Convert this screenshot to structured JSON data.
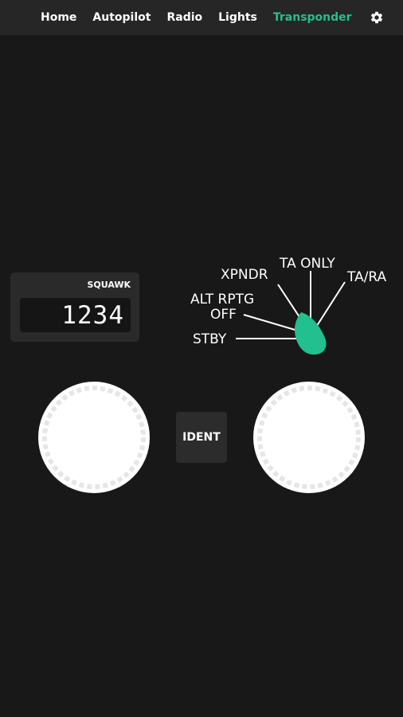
{
  "nav": {
    "items": [
      {
        "label": "Home",
        "active": false
      },
      {
        "label": "Autopilot",
        "active": false
      },
      {
        "label": "Radio",
        "active": false
      },
      {
        "label": "Lights",
        "active": false
      },
      {
        "label": "Transponder",
        "active": true
      }
    ],
    "settings_icon": "gear-icon",
    "active_color": "#22c08f"
  },
  "squawk": {
    "label": "SQUAWK",
    "code": "1234"
  },
  "mode_selector": {
    "modes": [
      "STBY",
      "ALT RPTG OFF",
      "XPNDR",
      "TA ONLY",
      "TA/RA"
    ],
    "labels": {
      "stby": "STBY",
      "alt_rptg": "ALT RPTG",
      "off": "OFF",
      "xpndr": "XPNDR",
      "ta_only": "TA ONLY",
      "ta_ra": "TA/RA"
    },
    "selected": "TA/RA",
    "knob_color": "#22c08f"
  },
  "ident": {
    "label": "IDENT"
  }
}
